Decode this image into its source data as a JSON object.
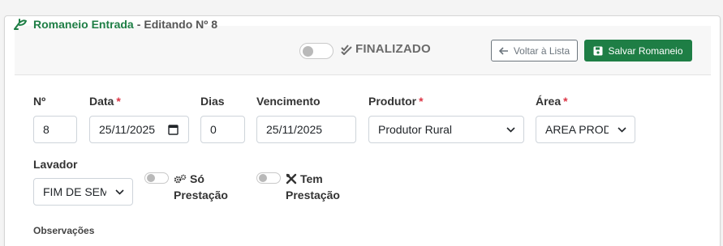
{
  "header": {
    "title": "Romaneio Entrada",
    "separator": "-",
    "edit_label": "Editando Nº 8",
    "status_label": "FINALIZADO",
    "back_button": "Voltar à Lista",
    "save_button": "Salvar Romaneio"
  },
  "form": {
    "numero": {
      "label": "Nº",
      "value": "8"
    },
    "data": {
      "label": "Data",
      "required": "*",
      "value": "25/11/2025"
    },
    "dias": {
      "label": "Dias",
      "value": "0"
    },
    "vencimento": {
      "label": "Vencimento",
      "value": "25/11/2025"
    },
    "produtor": {
      "label": "Produtor",
      "required": "*",
      "value": "Produtor Rural"
    },
    "area": {
      "label": "Área",
      "required": "*",
      "value": "AREA PROD"
    },
    "lavador": {
      "label": "Lavador",
      "value": "FIM DE SEM"
    },
    "so_prestacao": {
      "label_line1": "Só",
      "label_line2": "Prestação"
    },
    "tem_prestacao": {
      "label_line1": "Tem",
      "label_line2": "Prestação"
    },
    "observacoes": {
      "label": "Observações"
    }
  },
  "colors": {
    "primary_green": "#1e7e45",
    "required_red": "#dc3545"
  }
}
